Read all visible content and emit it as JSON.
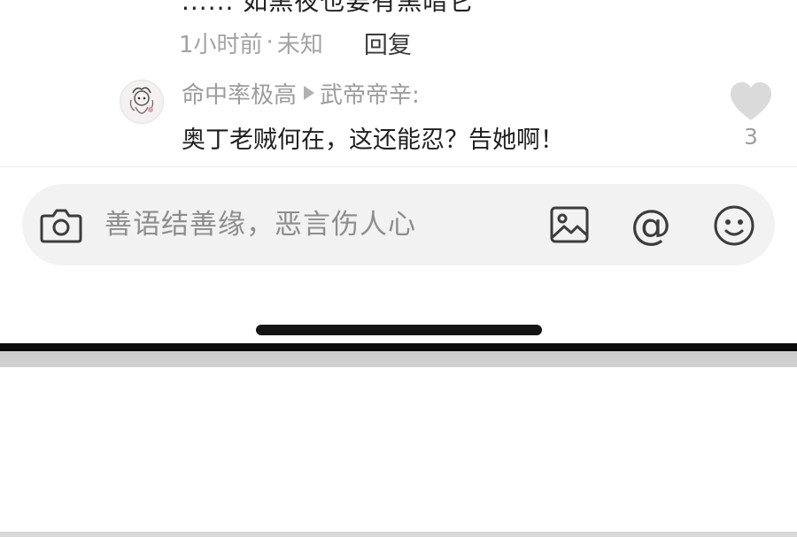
{
  "previous_comment": {
    "text_partial": "...... 如黑夜也要有黑暗它",
    "time": "1小时前",
    "separator": "·",
    "location": "未知",
    "reply_label": "回复"
  },
  "reply_comment": {
    "author": "命中率极高",
    "reply_to": "武帝帝辛:",
    "text": "奥丁老贼何在，这还能忍？告她啊！",
    "like_count": "3"
  },
  "input_bar": {
    "placeholder": "善语结善缘，恶言伤人心",
    "at_symbol": "@",
    "icons": [
      "camera-icon",
      "image-icon",
      "at-icon",
      "emoji-icon"
    ]
  },
  "colors": {
    "primary_text": "#1f1f1f",
    "secondary_text": "#a3a3a3",
    "input_background": "#f2f2f2",
    "like_icon": "#dadada"
  }
}
